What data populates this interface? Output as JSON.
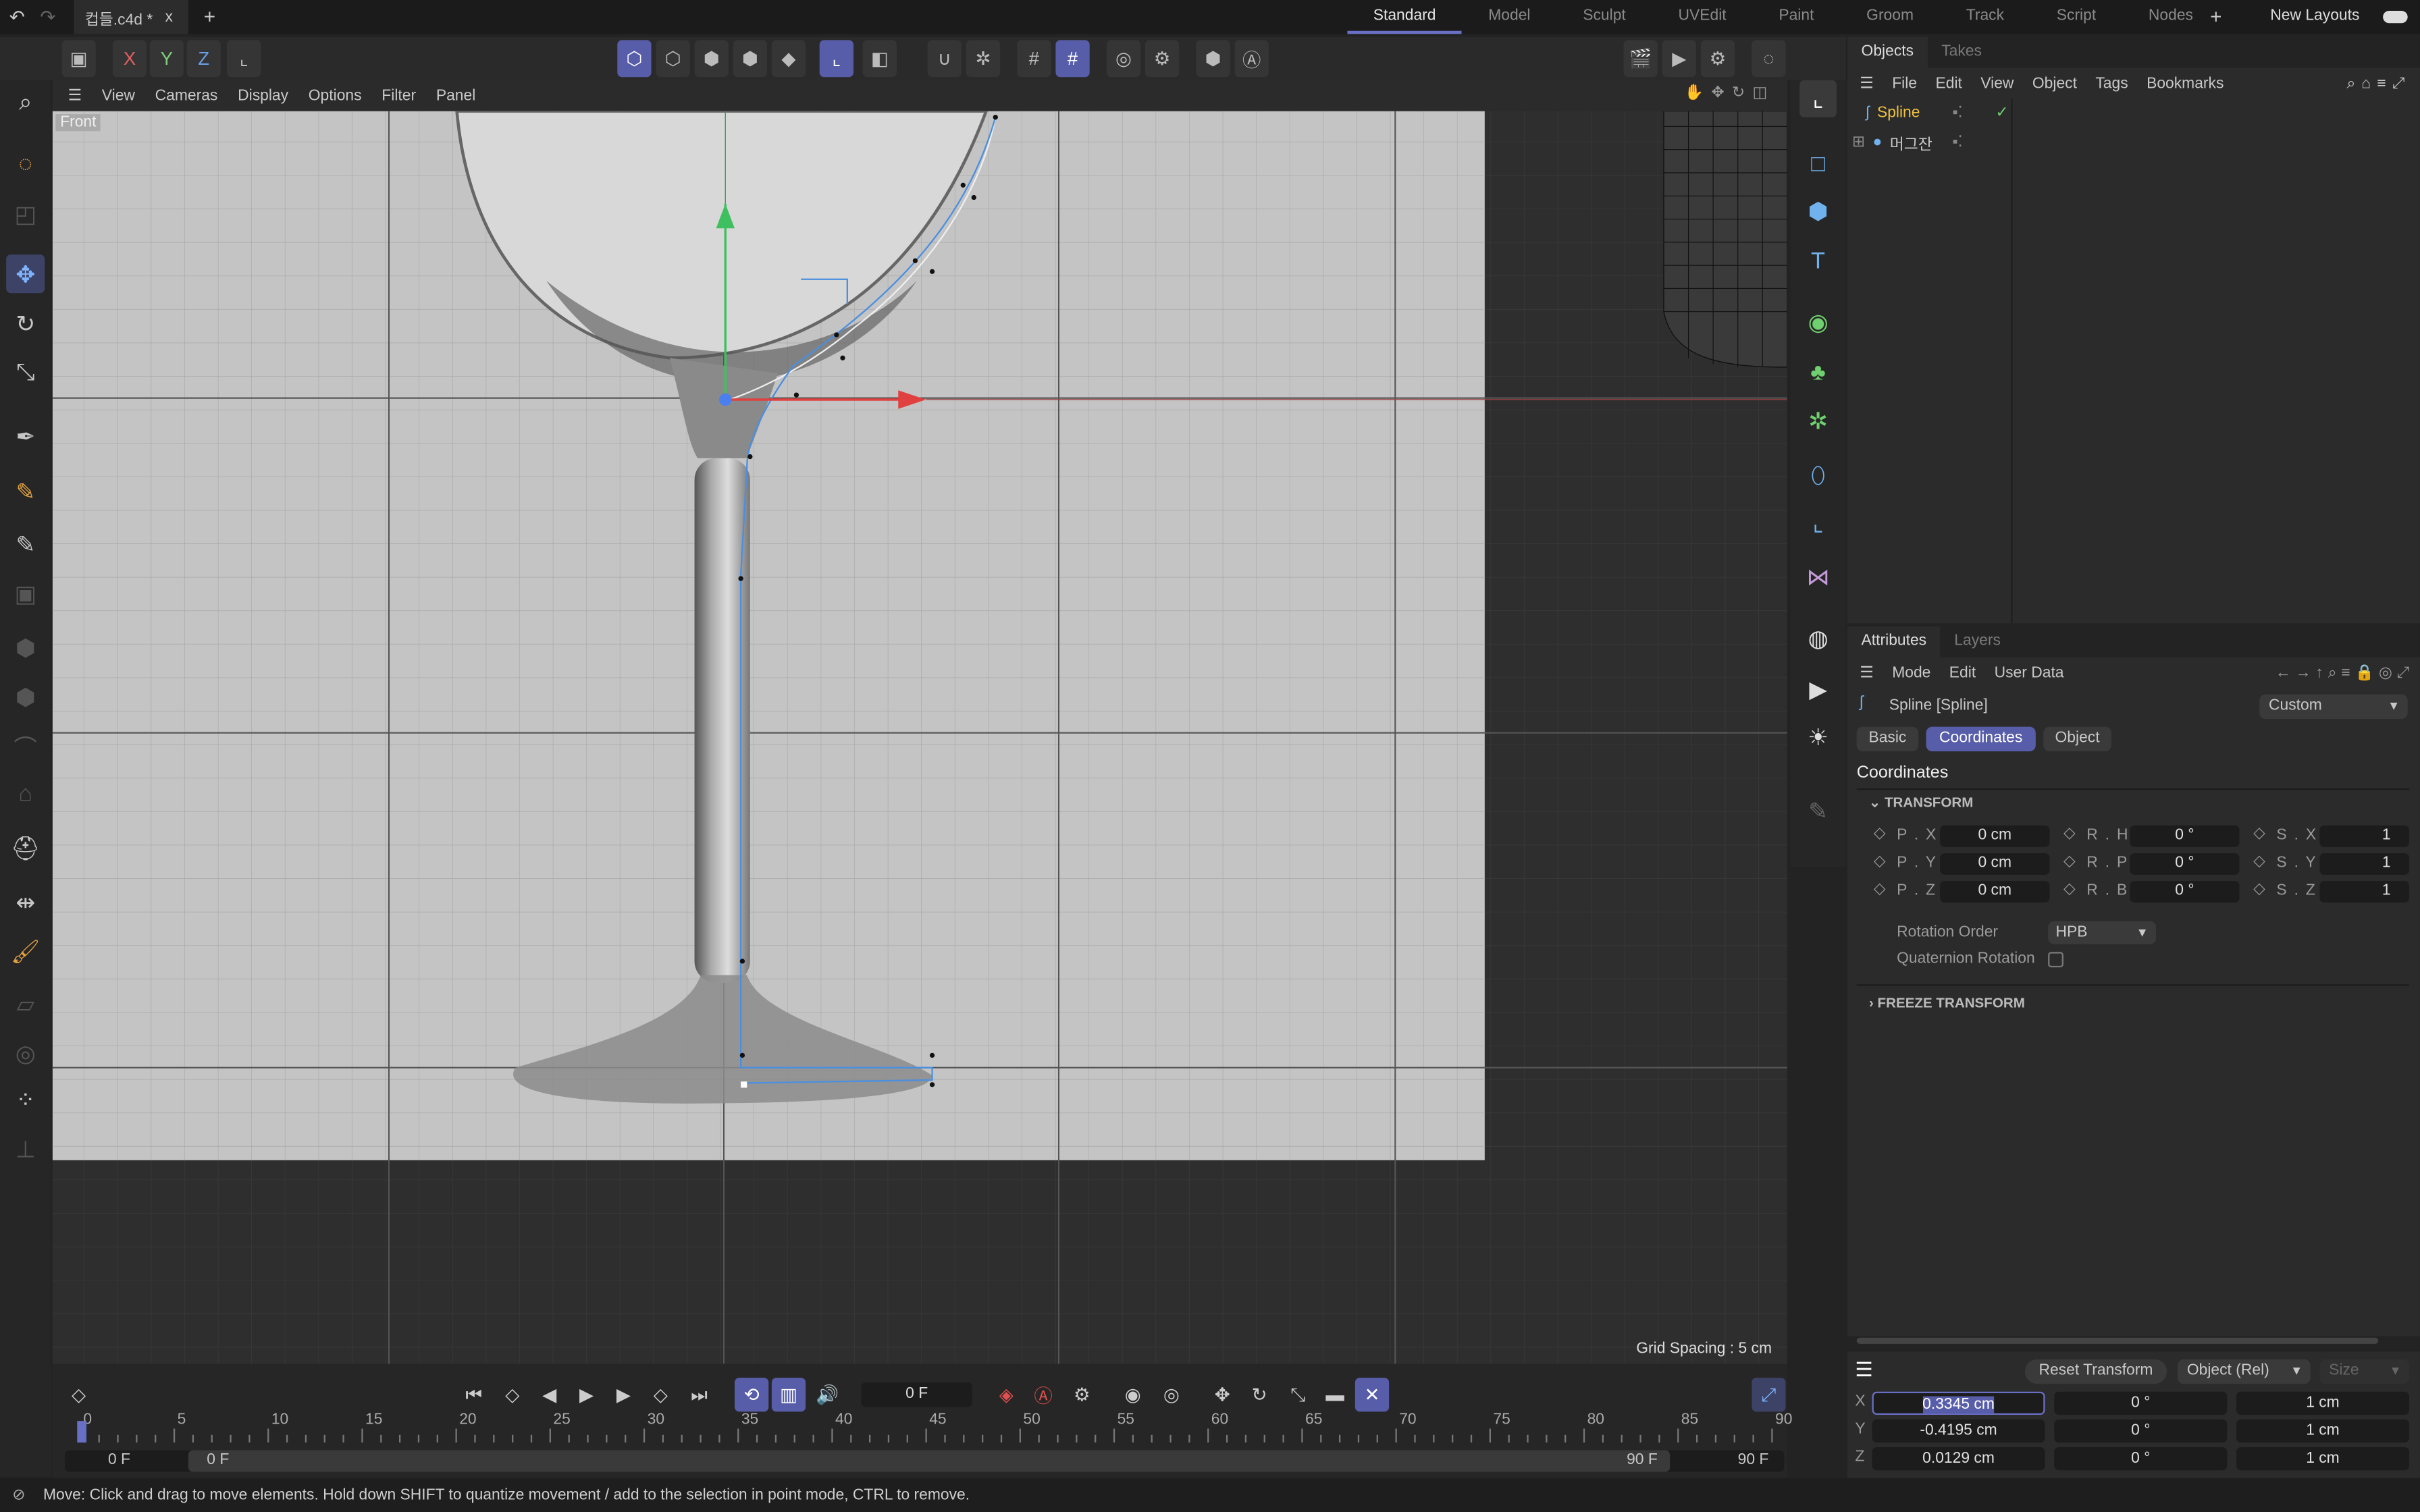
{
  "top": {
    "file_tab": "컵들.c4d *",
    "close": "x",
    "new_tab": "+",
    "layouts": [
      "Standard",
      "Model",
      "Sculpt",
      "UVEdit",
      "Paint",
      "Groom",
      "Track",
      "Script",
      "Nodes"
    ],
    "active_layout": "Standard",
    "new_layouts": "New Layouts"
  },
  "toolbar": {
    "x": "X",
    "y": "Y",
    "z": "Z"
  },
  "viewport": {
    "menu": [
      "View",
      "Cameras",
      "Display",
      "Options",
      "Filter",
      "Panel"
    ],
    "view_name": "Front",
    "grid_spacing": "Grid Spacing : 5 cm"
  },
  "objects": {
    "tabs": [
      "Objects",
      "Takes"
    ],
    "menu": [
      "File",
      "Edit",
      "View",
      "Object",
      "Tags",
      "Bookmarks"
    ],
    "items": [
      {
        "name": "Spline",
        "selected": true
      },
      {
        "name": "머그잔",
        "selected": false
      }
    ]
  },
  "attributes": {
    "tabs": [
      "Attributes",
      "Layers"
    ],
    "menu": [
      "Mode",
      "Edit",
      "User Data"
    ],
    "object_title": "Spline [Spline]",
    "preset": "Custom",
    "subtabs": [
      "Basic",
      "Coordinates",
      "Object"
    ],
    "active_subtab": "Coordinates",
    "section": "Coordinates",
    "transform": "TRANSFORM",
    "rows": [
      {
        "p_label": "P . X",
        "p": "0 cm",
        "r_label": "R . H",
        "r": "0 °",
        "s_label": "S . X",
        "s": "1"
      },
      {
        "p_label": "P . Y",
        "p": "0 cm",
        "r_label": "R . P",
        "r": "0 °",
        "s_label": "S . Y",
        "s": "1"
      },
      {
        "p_label": "P . Z",
        "p": "0 cm",
        "r_label": "R . B",
        "r": "0 °",
        "s_label": "S . Z",
        "s": "1"
      }
    ],
    "rotation_order_label": "Rotation Order",
    "rotation_order": "HPB",
    "quaternion_label": "Quaternion Rotation",
    "quaternion": false,
    "freeze": "FREEZE TRANSFORM"
  },
  "coord_manager": {
    "reset": "Reset Transform",
    "mode": "Object (Rel)",
    "size_mode": "Size",
    "rows": [
      {
        "axis": "X",
        "pos": "0.3345 cm",
        "rot": "0 °",
        "size": "1 cm"
      },
      {
        "axis": "Y",
        "pos": "-0.4195 cm",
        "rot": "0 °",
        "size": "1 cm"
      },
      {
        "axis": "Z",
        "pos": "0.0129 cm",
        "rot": "0 °",
        "size": "1 cm"
      }
    ]
  },
  "timeline": {
    "current_frame": "0 F",
    "ticks": [
      "0",
      "5",
      "10",
      "15",
      "20",
      "25",
      "30",
      "35",
      "40",
      "45",
      "50",
      "55",
      "60",
      "65",
      "70",
      "75",
      "80",
      "85",
      "90"
    ],
    "start": "0 F",
    "start2": "0 F",
    "end": "90 F",
    "end2": "90 F"
  },
  "status": "Move: Click and drag to move elements. Hold down SHIFT to quantize movement / add to the selection in point mode, CTRL to remove."
}
